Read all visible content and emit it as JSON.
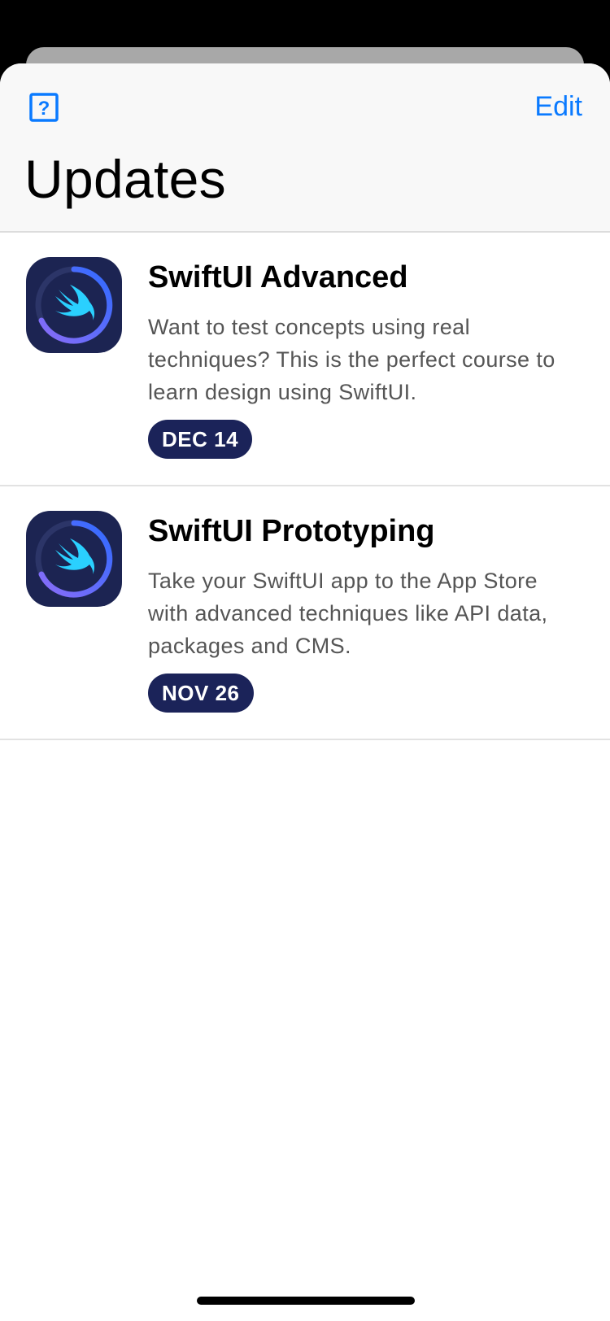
{
  "header": {
    "title": "Updates",
    "edit_label": "Edit",
    "help_icon": "help-icon",
    "accent_color": "#0a7aff"
  },
  "updates": [
    {
      "title": "SwiftUI Advanced",
      "description": "Want to test concepts using real techniques? This is the perfect course to learn design using SwiftUI.",
      "date": "DEC 14",
      "icon": "swift-logo-icon"
    },
    {
      "title": "SwiftUI Prototyping",
      "description": "Take your SwiftUI app to the App Store with advanced techniques like API data, packages and CMS.",
      "date": "NOV 26",
      "icon": "swift-logo-icon"
    }
  ],
  "colors": {
    "badge_bg": "#1b2359",
    "icon_bg": "#1c2452",
    "ring_start": "#8a6cf7",
    "ring_end": "#2f6bff",
    "swift_bird": "#2ad0ff"
  }
}
